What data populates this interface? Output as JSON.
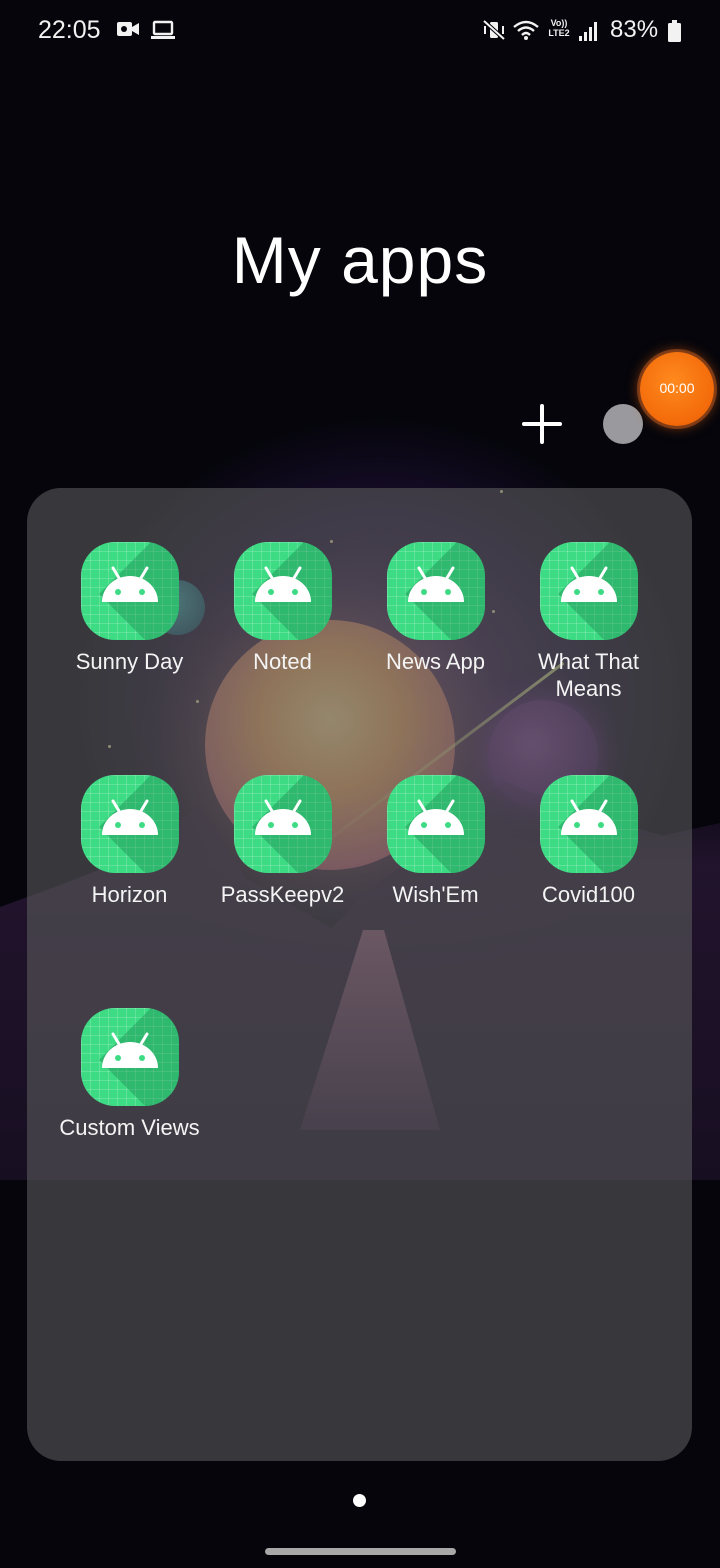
{
  "status_bar": {
    "time": "22:05",
    "volte_line1": "Vo))",
    "volte_line2": "LTE2",
    "battery": "83%"
  },
  "header": {
    "title": "My apps"
  },
  "recorder": {
    "elapsed": "00:00",
    "color": "#f36a0a"
  },
  "folder": {
    "apps": [
      {
        "label": "Sunny Day",
        "icon": "android-robot-icon"
      },
      {
        "label": "Noted",
        "icon": "android-robot-icon"
      },
      {
        "label": "News App",
        "icon": "android-robot-icon"
      },
      {
        "label": "What That Means",
        "icon": "android-robot-icon"
      },
      {
        "label": "Horizon",
        "icon": "android-robot-icon"
      },
      {
        "label": "PassKeepv2",
        "icon": "android-robot-icon"
      },
      {
        "label": "Wish'Em",
        "icon": "android-robot-icon"
      },
      {
        "label": "Covid100",
        "icon": "android-robot-icon"
      },
      {
        "label": "Custom Views",
        "icon": "android-robot-icon"
      }
    ],
    "icon_color": "#3ddc84"
  },
  "pager": {
    "current_page": 1,
    "total_pages": 1
  }
}
